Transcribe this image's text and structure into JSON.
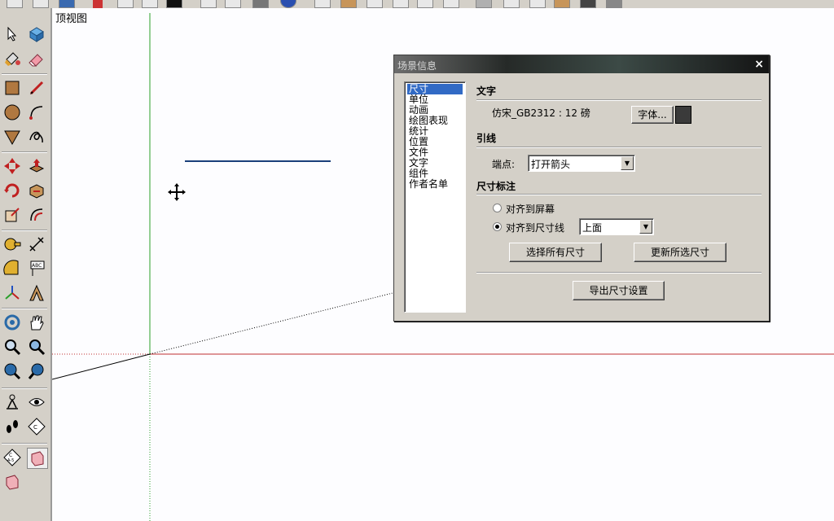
{
  "viewport": {
    "view_label": "顶视图",
    "axis_colors": {
      "green": "#2aa02a",
      "red": "#c03030",
      "line": "#1a3f7a"
    }
  },
  "toolbar": {
    "top_icons": [
      "new-icon",
      "open-icon",
      "save-icon",
      "cut-icon",
      "copy-icon",
      "paste-icon",
      "erase-icon",
      "undo-icon",
      "redo-icon",
      "print-icon",
      "info-icon",
      "iso-icon",
      "top-icon",
      "front-icon",
      "right-icon",
      "back-icon",
      "left-icon",
      "xray-icon",
      "wireframe-icon",
      "hidden-line-icon",
      "shaded-icon",
      "textured-icon",
      "monochrome-icon"
    ],
    "left_icons": [
      "select-icon",
      "component-icon",
      "paint-bucket-icon",
      "eraser-icon",
      "rectangle-icon",
      "line-icon",
      "circle-icon",
      "arc-icon",
      "polygon-icon",
      "freehand-icon",
      "move-icon",
      "push-pull-icon",
      "rotate-icon",
      "follow-me-icon",
      "scale-icon",
      "offset-icon",
      "tape-measure-icon",
      "dimension-icon",
      "protractor-icon",
      "text-icon",
      "axes-icon",
      "3d-text-icon",
      "orbit-icon",
      "pan-icon",
      "zoom-icon",
      "zoom-window-icon",
      "zoom-extents-icon",
      "previous-icon",
      "position-camera-icon",
      "look-around-icon",
      "walk-icon",
      "section-plane-icon",
      "section-icon",
      "section-display-icon",
      "section-fill-icon"
    ]
  },
  "dialog": {
    "title": "场景信息",
    "close": "×",
    "nav": [
      "尺寸",
      "单位",
      "动画",
      "绘图表现",
      "统计",
      "位置",
      "文件",
      "文字",
      "组件",
      "作者名单"
    ],
    "text_section": {
      "title": "文字",
      "font_value": "仿宋_GB2312 : 12 磅",
      "font_button": "字体..."
    },
    "leader_section": {
      "title": "引线",
      "endpoint_label": "端点:",
      "endpoint_value": "打开箭头"
    },
    "dimension_section": {
      "title": "尺寸标注",
      "align_screen": "对齐到屏幕",
      "align_dimline": "对齐到尺寸线",
      "align_value": "上面",
      "select_all_button": "选择所有尺寸",
      "update_button": "更新所选尺寸",
      "export_button": "导出尺寸设置"
    }
  }
}
